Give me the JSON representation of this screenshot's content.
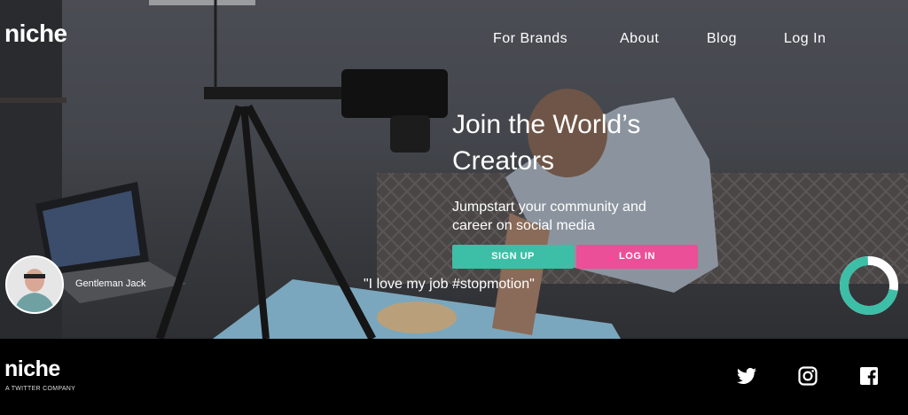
{
  "header": {
    "logo": "niche",
    "nav": [
      "For Brands",
      "About",
      "Blog",
      "Log In"
    ]
  },
  "hero": {
    "headline": "Join the World’s Creators",
    "subline": "Jumpstart your community and career on social media",
    "signup_label": "SIGN UP",
    "login_label": "LOG IN",
    "quote": "\"I love my job #stopmotion\"",
    "creator_name": "Gentleman Jack"
  },
  "footer": {
    "logo": "niche",
    "tagline": "A TWITTER COMPANY",
    "social_icons": [
      "twitter-icon",
      "instagram-icon",
      "facebook-icon"
    ]
  },
  "colors": {
    "signup": "#3cbfa6",
    "login": "#ea4f97",
    "ring": "#3cbfa6"
  }
}
